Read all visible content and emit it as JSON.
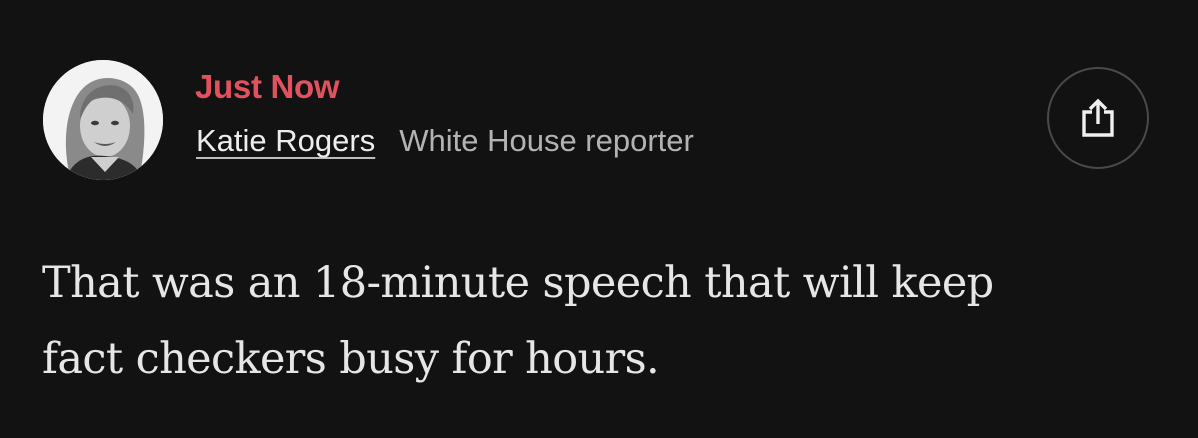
{
  "post": {
    "timestamp": "Just Now",
    "author": {
      "name": "Katie Rogers",
      "role": "White House reporter"
    },
    "body_lines": [
      "That was an 18-minute speech that will keep",
      "fact checkers busy for hours."
    ],
    "share_icon": "share-icon"
  },
  "colors": {
    "background": "#121212",
    "timestamp": "#e2525e",
    "author_name": "#ededed",
    "author_role": "#b3b3b3",
    "body_text": "#e6e6e6"
  }
}
